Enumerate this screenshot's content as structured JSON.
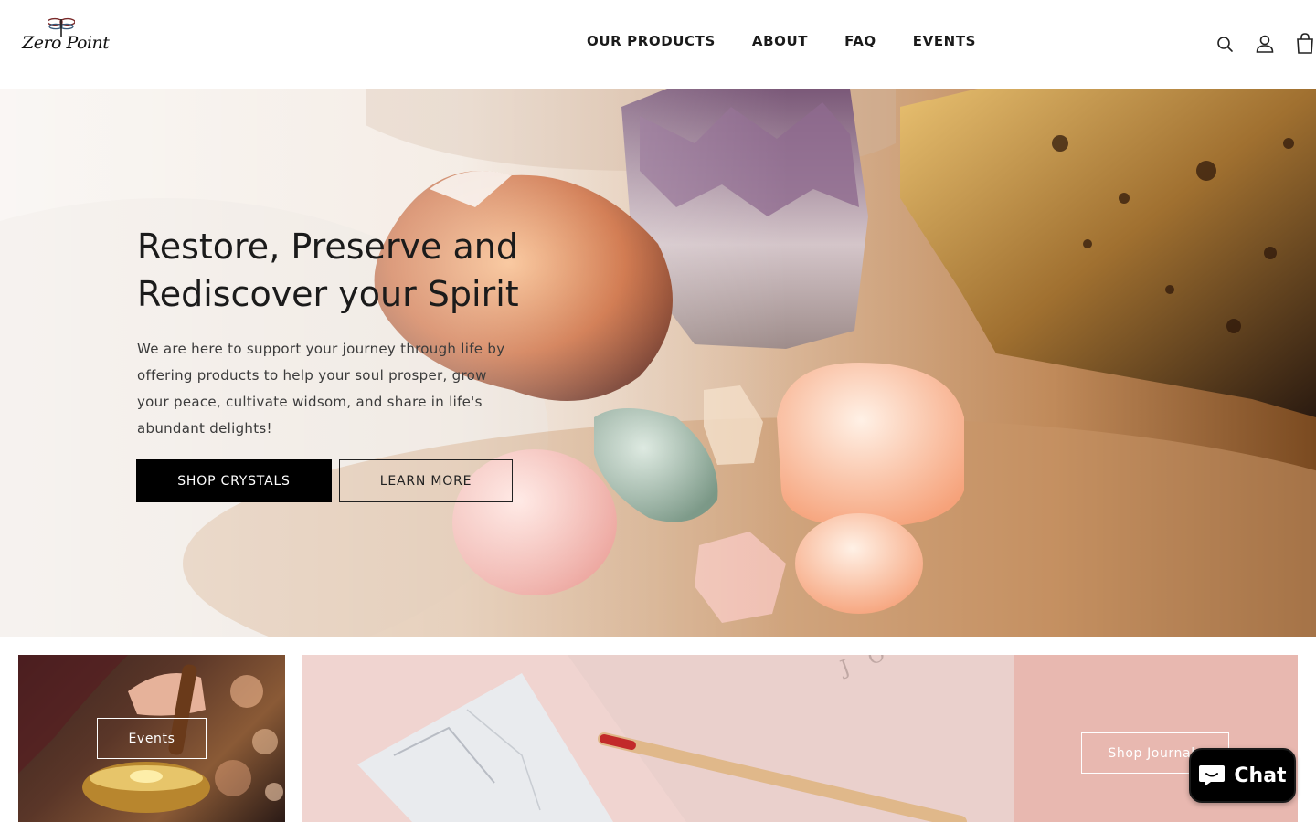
{
  "header": {
    "logo_text": "Zero Point",
    "nav": [
      "OUR PRODUCTS",
      "ABOUT",
      "FAQ",
      "EVENTS"
    ],
    "icons": [
      "search-icon",
      "account-icon",
      "cart-icon"
    ]
  },
  "hero": {
    "title": "Restore, Preserve and Rediscover your Spirit",
    "text": "We are here to support your journey through life by offering products to help your soul prosper, grow your peace, cultivate widsom, and share in life's abundant delights!",
    "primary_button": "SHOP CRYSTALS",
    "secondary_button": "LEARN MORE"
  },
  "tiles": {
    "events_button": "Events",
    "journal_button": "Shop Journals"
  },
  "chat": {
    "label": "Chat"
  },
  "colors": {
    "accent_dark": "#000000",
    "journal_tile": "#e8b8b0"
  }
}
